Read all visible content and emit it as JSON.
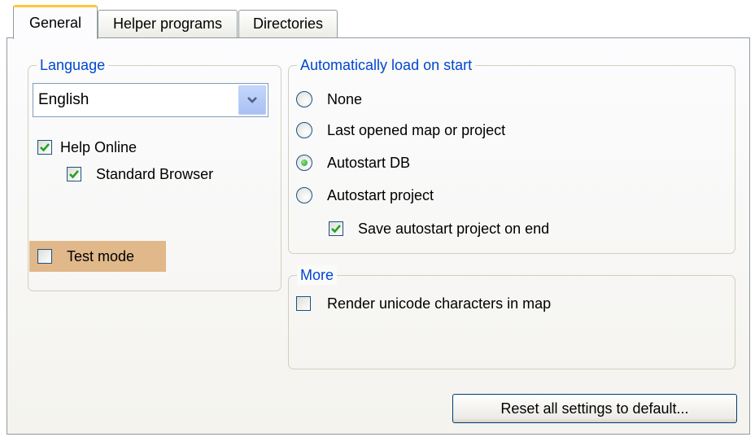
{
  "tabs": [
    {
      "label": "General",
      "active": true
    },
    {
      "label": "Helper programs",
      "active": false
    },
    {
      "label": "Directories",
      "active": false
    }
  ],
  "language": {
    "legend": "Language",
    "selected": "English",
    "help_online": {
      "label": "Help Online",
      "checked": true
    },
    "standard_browser": {
      "label": "Standard Browser",
      "checked": true
    },
    "test_mode": {
      "label": "Test mode",
      "checked": false
    }
  },
  "autoload": {
    "legend": "Automatically load on start",
    "options": [
      {
        "label": "None",
        "selected": false
      },
      {
        "label": "Last opened map or project",
        "selected": false
      },
      {
        "label": "Autostart DB",
        "selected": true
      },
      {
        "label": "Autostart project",
        "selected": false
      }
    ],
    "save_autostart": {
      "label": "Save autostart project on end",
      "checked": true
    }
  },
  "more": {
    "legend": "More",
    "render_unicode": {
      "label": "Render unicode characters in map",
      "checked": false
    }
  },
  "reset_button": "Reset all settings to default...",
  "colors": {
    "accent_tab": "#ffc83c",
    "legend_text": "#0046d5",
    "highlight": "#e0b88a",
    "check": "#21a121"
  }
}
